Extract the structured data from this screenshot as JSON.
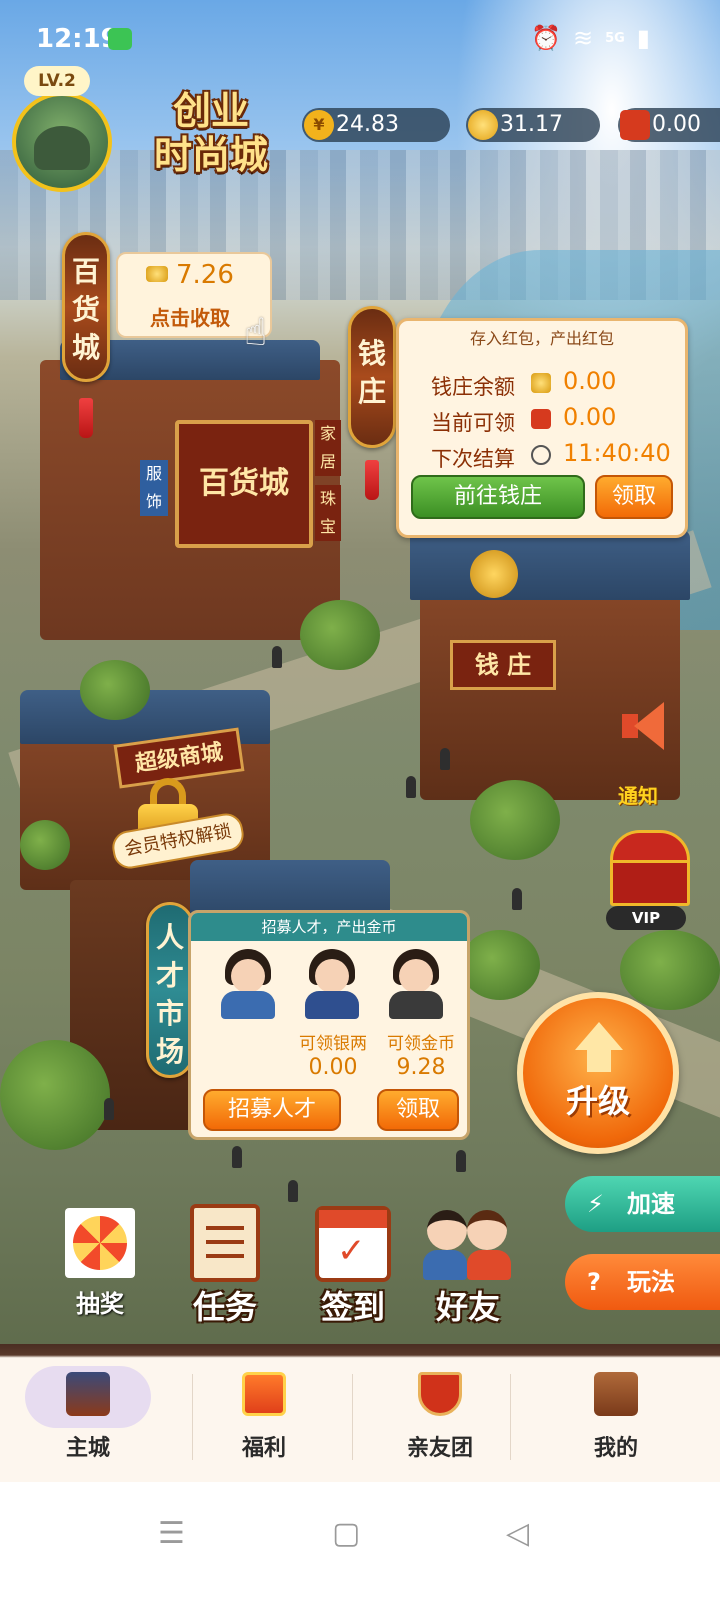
{
  "status_bar": {
    "time": "12:19",
    "network": "5G"
  },
  "header": {
    "level": "LV.2",
    "logo_line1": "创业",
    "logo_line2": "时尚城",
    "currencies": [
      {
        "icon": "yuan-coin-icon",
        "symbol": "¥",
        "value": "24.83",
        "color": "#f2b21c"
      },
      {
        "icon": "gold-ingot-icon",
        "symbol": "",
        "value": "31.17",
        "color": "#f5c23a"
      },
      {
        "icon": "red-envelope-icon",
        "symbol": "",
        "value": "0.00",
        "color": "#d63a1e"
      }
    ]
  },
  "department_store": {
    "sign": [
      "百",
      "货",
      "城"
    ],
    "bubble_amount": "7.26",
    "bubble_action": "点击收取",
    "building_label": "百货城",
    "side_labels": [
      "服饰",
      "家居",
      "珠宝"
    ]
  },
  "bank": {
    "sign": [
      "钱",
      "庄"
    ],
    "panel_title": "存入红包，产出红包",
    "balance_label": "钱庄余额",
    "balance_value": "0.00",
    "claimable_label": "当前可领",
    "claimable_value": "0.00",
    "next_label": "下次结算",
    "next_value": "11:40:40",
    "goto_button": "前往钱庄",
    "claim_button": "领取",
    "building_label": "钱 庄"
  },
  "super_mall": {
    "building_label": "超级商城",
    "lock_label": "会员特权解锁"
  },
  "talent_market": {
    "sign": [
      "人",
      "才",
      "市",
      "场"
    ],
    "panel_title": "招募人才，产出金币",
    "silver_label": "可领银两",
    "silver_value": "0.00",
    "gold_label": "可领金币",
    "gold_value": "9.28",
    "recruit_button": "招募人才",
    "claim_button": "领取"
  },
  "right_side": {
    "notify_label": "通知",
    "vip_label": "VIP",
    "upgrade_label": "升级",
    "speed_label": "加速",
    "rules_label": "玩法"
  },
  "quick_actions": {
    "lottery": "抽奖",
    "tasks": "任务",
    "checkin": "签到",
    "friends": "好友"
  },
  "bottom_nav": [
    {
      "label": "主城",
      "icon": "main-city-icon",
      "active": true
    },
    {
      "label": "福利",
      "icon": "gift-icon",
      "active": false
    },
    {
      "label": "亲友团",
      "icon": "banner-icon",
      "active": false
    },
    {
      "label": "我的",
      "icon": "book-icon",
      "active": false
    }
  ]
}
